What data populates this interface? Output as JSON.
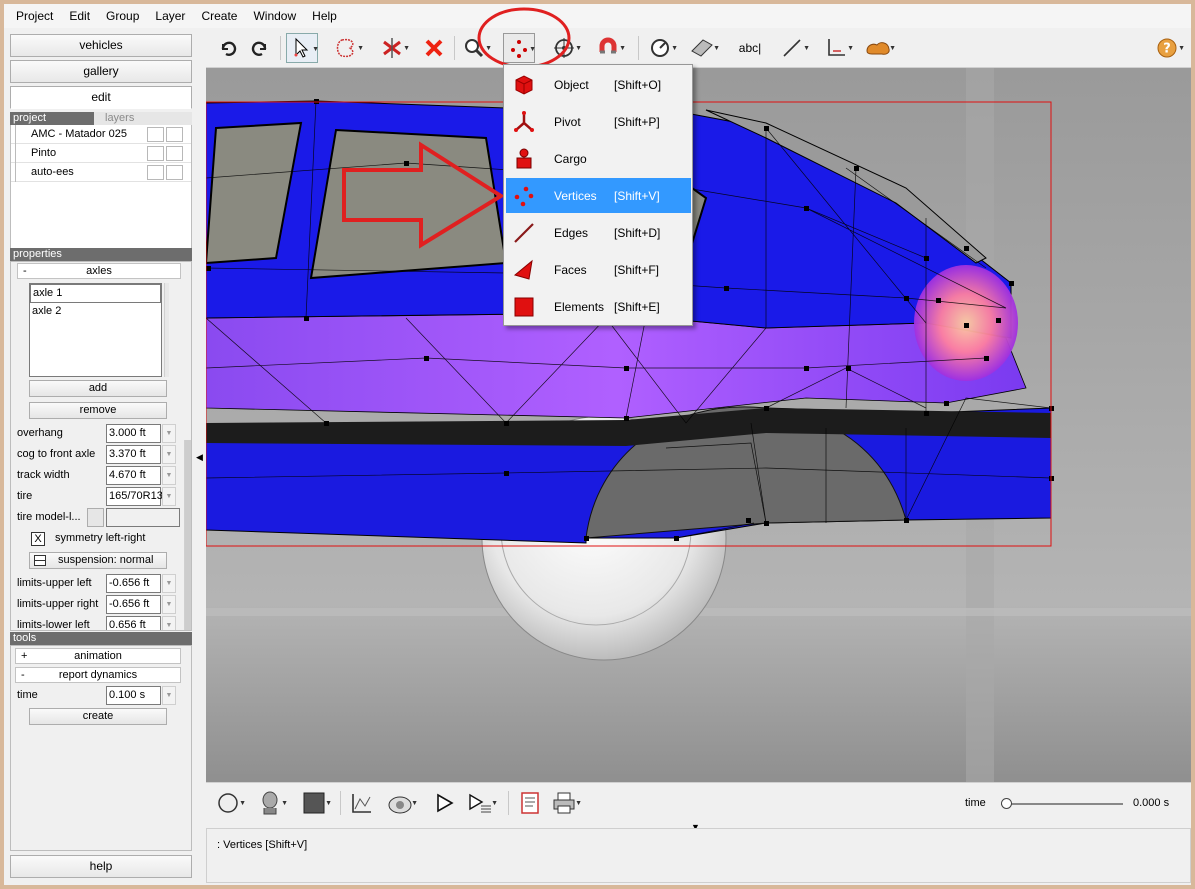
{
  "menubar": [
    "Project",
    "Edit",
    "Group",
    "Layer",
    "Create",
    "Window",
    "Help"
  ],
  "left": {
    "vehicles": "vehicles",
    "gallery": "gallery",
    "edit": "edit",
    "tab_project": "project",
    "tab_layers": "layers",
    "project_items": [
      "AMC - Matador 025",
      "Pinto",
      "auto-ees"
    ],
    "properties_header": "properties",
    "axles_group": "axles",
    "axles_sign": "-",
    "axles": [
      "axle 1",
      "axle 2"
    ],
    "add": "add",
    "remove": "remove",
    "props": [
      {
        "label": "overhang",
        "value": "3.000 ft"
      },
      {
        "label": "cog to front axle",
        "value": "3.370 ft"
      },
      {
        "label": "track width",
        "value": "4.670 ft"
      },
      {
        "label": "tire",
        "value": "165/70R13"
      }
    ],
    "tire_model_label": "tire model-l...",
    "symmetry": "symmetry left-right",
    "symmetry_mark": "X",
    "suspension": "suspension: normal",
    "limits": [
      {
        "label": "limits-upper left",
        "value": "-0.656 ft"
      },
      {
        "label": "limits-upper right",
        "value": "-0.656 ft"
      },
      {
        "label": "limits-lower left",
        "value": "0.656 ft"
      }
    ],
    "tools_header": "tools",
    "animation": "animation",
    "animation_sign": "+",
    "report_dynamics": "report dynamics",
    "report_sign": "-",
    "time_label": "time",
    "time_value": "0.100 s",
    "create": "create",
    "help": "help"
  },
  "toolbar": {
    "text_tool": "abc|"
  },
  "dropdown": {
    "items": [
      {
        "label": "Object",
        "shortcut": "[Shift+O]",
        "icon": "cube-icon"
      },
      {
        "label": "Pivot",
        "shortcut": "[Shift+P]",
        "icon": "pivot-icon"
      },
      {
        "label": "Cargo",
        "shortcut": "",
        "icon": "cargo-icon"
      },
      {
        "label": "Vertices",
        "shortcut": "[Shift+V]",
        "icon": "vertices-icon"
      },
      {
        "label": "Edges",
        "shortcut": "[Shift+D]",
        "icon": "edges-icon"
      },
      {
        "label": "Faces",
        "shortcut": "[Shift+F]",
        "icon": "faces-icon"
      },
      {
        "label": "Elements",
        "shortcut": "[Shift+E]",
        "icon": "elements-icon"
      }
    ],
    "selected": "Vertices"
  },
  "bottom": {
    "time_label": "time",
    "time_value": "0.000 s",
    "time_position": 0
  },
  "status": {
    "text": ": Vertices [Shift+V]"
  },
  "colors": {
    "highlight": "#3399ff",
    "annotation_red": "#e02020",
    "car_blue": "#1a1aee"
  }
}
